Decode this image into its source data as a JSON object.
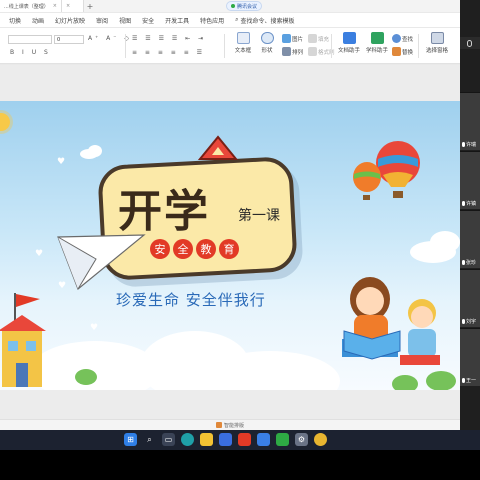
{
  "tabs": [
    {
      "label": "...线上课表（整理）"
    },
    {
      "label": ""
    }
  ],
  "new_tab_symbol": "+",
  "meeting": {
    "label": "腾讯会议"
  },
  "menu": [
    "切换",
    "动画",
    "幻灯片放映",
    "审阅",
    "视图",
    "安全",
    "开发工具",
    "特色应用"
  ],
  "menu_search": "查找命令、搜索模板",
  "ribbon": {
    "font_size_value": "0",
    "format_glyphs_row1": "A⁺ A⁻ ◇",
    "format_glyphs_row2": "B I U S",
    "para_glyphs_row1": "☰ ☰ ☰ ☰ ⇤ ⇥",
    "para_glyphs_row2": "≡ ≡ ≡ ≡ ≡ ☰",
    "text_box": "文本框",
    "shape": "形状",
    "picture": "图片",
    "arrange": "排列",
    "fill": "填充",
    "format_painter": "格式刷",
    "text_helper": "文档助手",
    "subject_helper": "学科助手",
    "find": "查找",
    "replace": "替换",
    "select_pane": "选择窗格"
  },
  "slide": {
    "title": "开学",
    "lesson": "第一课",
    "badge_chars": [
      "安",
      "全",
      "教",
      "育"
    ],
    "slogan": "珍爱生命  安全伴我行"
  },
  "participants": [
    {
      "name": "许瑞"
    },
    {
      "name": "许镇"
    },
    {
      "name": "张珍"
    },
    {
      "name": "刘宇"
    },
    {
      "name": "王一"
    }
  ],
  "status_bar": {
    "label": "智能排版"
  },
  "colors": {
    "accent_red": "#e23a26",
    "slogan_blue": "#2a6ab8",
    "sign_yellow": "#fbe9a8",
    "panel_dark": "#1f1f1f",
    "taskbar": "#1c2230"
  },
  "taskbar_icons": [
    "windows-icon",
    "search-icon",
    "task-view-icon",
    "edge-icon",
    "folder-icon",
    "store-icon",
    "wps-icon",
    "tencent-meeting-icon",
    "wechat-icon",
    "settings-icon",
    "chrome-icon"
  ]
}
